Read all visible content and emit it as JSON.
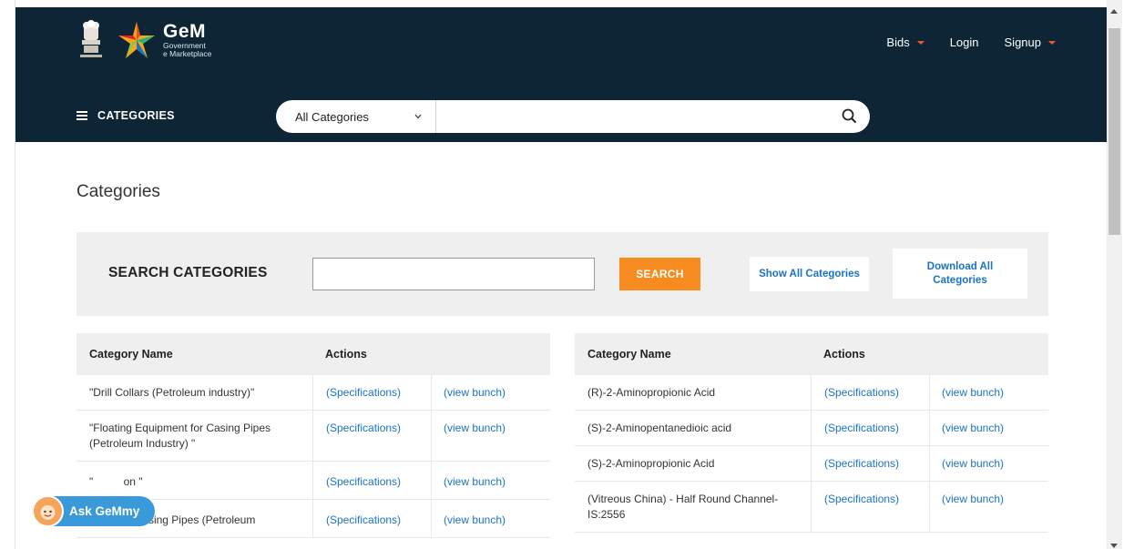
{
  "header": {
    "brand_name": "GeM",
    "brand_sub1": "Government",
    "brand_sub2": "e Marketplace",
    "nav": {
      "bids": "Bids",
      "login": "Login",
      "signup": "Signup"
    }
  },
  "catbar": {
    "categories_label": "CATEGORIES",
    "selected_category": "All Categories",
    "search_value": ""
  },
  "page": {
    "title": "Categories",
    "search_label": "SEARCH CATEGORIES",
    "search_value": "",
    "search_button": "SEARCH",
    "show_all": "Show All Categories",
    "download_all": "Download All Categories"
  },
  "table_headers": {
    "name": "Category Name",
    "actions": "Actions"
  },
  "left_rows": [
    {
      "name": "\"Drill Collars (Petroleum industry)\"",
      "spec": "(Specifications)",
      "view": "(view bunch)"
    },
    {
      "name": "\"Floating Equipment for Casing Pipes (Petroleum Industry) \"",
      "spec": "(Specifications)",
      "view": "(view bunch)"
    },
    {
      "name": "\"          on \"",
      "spec": "(Specifications)",
      "view": "(view bunch)"
    },
    {
      "name": "\"Regular Casing Pipes (Petroleum",
      "spec": "(Specifications)",
      "view": "(view bunch)"
    }
  ],
  "right_rows": [
    {
      "name": "(R)-2-Aminopropionic Acid",
      "spec": "(Specifications)",
      "view": "(view bunch)"
    },
    {
      "name": "(S)-2-Aminopentanedioic acid",
      "spec": "(Specifications)",
      "view": "(view bunch)"
    },
    {
      "name": "(S)-2-Aminopropionic Acid",
      "spec": "(Specifications)",
      "view": "(view bunch)"
    },
    {
      "name": "(Vitreous China) - Half Round Channel- IS:2556",
      "spec": "(Specifications)",
      "view": "(view bunch)"
    }
  ],
  "chat_widget": {
    "label": "Ask GeMmy"
  },
  "colors": {
    "header_bg": "#0d2534",
    "accent_orange": "#f68b1f",
    "link_blue": "#1a73c4",
    "chat_blue": "#3a9ad9"
  }
}
